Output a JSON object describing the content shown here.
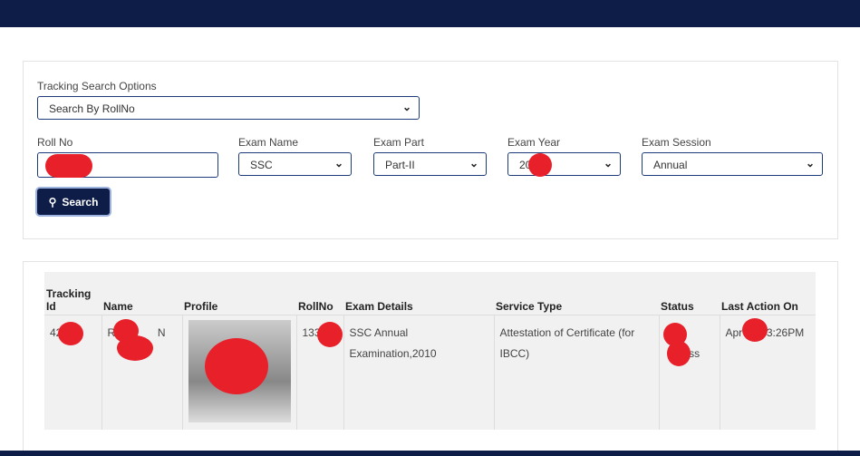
{
  "search": {
    "options_label": "Tracking Search Options",
    "options_value": "Search By RollNo",
    "rollno_label": "Roll No",
    "rollno_value": "",
    "exam_name_label": "Exam Name",
    "exam_name_value": "SSC",
    "exam_part_label": "Exam Part",
    "exam_part_value": "Part-II",
    "exam_year_label": "Exam Year",
    "exam_year_value": "20",
    "exam_session_label": "Exam Session",
    "exam_session_value": "Annual",
    "search_button": "Search"
  },
  "table": {
    "headers": [
      "Tracking Id",
      "Name",
      "Profile",
      "RollNo",
      "Exam Details",
      "Service Type",
      "Status",
      "Last Action On"
    ],
    "rows": [
      {
        "id": "42  6",
        "name": "R    M       N",
        "rollno": "133",
        "exam_details": "SSC Annual Examination,2010",
        "service_type": "Attestation of Certificate (for IBCC)",
        "status": "ess",
        "last_action": "Apr    024 3:26PM"
      }
    ]
  },
  "colors": {
    "navy": "#0e1d48",
    "redaction": "#e8202a"
  }
}
